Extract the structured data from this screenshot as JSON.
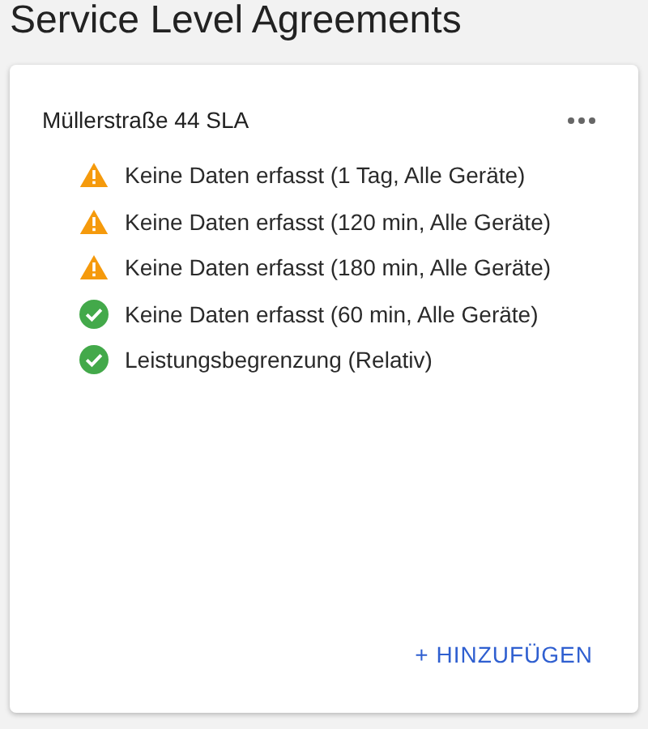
{
  "page_title": "Service Level Agreements",
  "card": {
    "title": "Müllerstraße 44 SLA",
    "items": [
      {
        "label": "Keine Daten erfasst (1 Tag, Alle Geräte)",
        "kind": "warning"
      },
      {
        "label": "Keine Daten erfasst (120 min, Alle Geräte)",
        "kind": "warning"
      },
      {
        "label": "Keine Daten erfasst (180 min, Alle Geräte)",
        "kind": "warning"
      },
      {
        "label": "Keine Daten erfasst (60 min, Alle Geräte)",
        "kind": "ok"
      },
      {
        "label": "Leistungsbegrenzung (Relativ)",
        "kind": "ok"
      }
    ],
    "add_button": "+ HINZUFÜGEN"
  }
}
